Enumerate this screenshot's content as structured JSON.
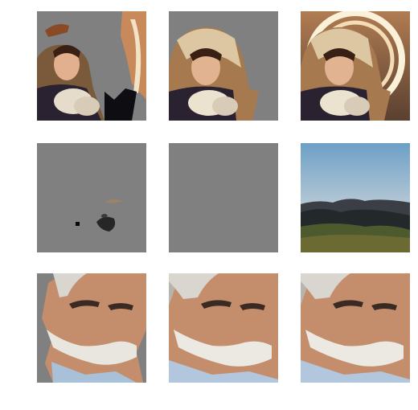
{
  "grid": {
    "rows": [
      {
        "subject": "woman-in-fur-hood",
        "tiles": [
          {
            "content": "masked-partial",
            "icon": "image-icon"
          },
          {
            "content": "masked-subject",
            "icon": "image-icon"
          },
          {
            "content": "original",
            "icon": "image-icon"
          }
        ]
      },
      {
        "subject": "mountain-landscape",
        "tiles": [
          {
            "content": "masked-mostly-gray",
            "icon": "image-icon"
          },
          {
            "content": "fully-masked",
            "icon": "image-icon"
          },
          {
            "content": "original",
            "icon": "image-icon"
          }
        ]
      },
      {
        "subject": "elderly-man-portrait",
        "tiles": [
          {
            "content": "masked-partial",
            "icon": "image-icon"
          },
          {
            "content": "mostly-original",
            "icon": "image-icon"
          },
          {
            "content": "original",
            "icon": "image-icon"
          }
        ]
      }
    ]
  },
  "colors": {
    "mask_gray": "#808080",
    "page_background": "#ffffff"
  }
}
